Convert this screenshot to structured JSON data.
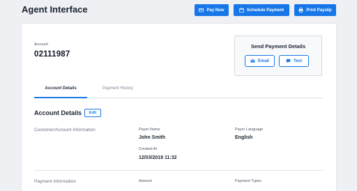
{
  "header": {
    "title": "Agent Interface",
    "buttons": [
      {
        "label": "Pay Now",
        "icon": "card-icon"
      },
      {
        "label": "Schedule Payment",
        "icon": "calendar-icon"
      },
      {
        "label": "Print Payslip",
        "icon": "printer-icon"
      }
    ]
  },
  "account": {
    "label": "Account",
    "number": "02111987"
  },
  "send_payment": {
    "title": "Send Payment Details",
    "email_label": "Email",
    "text_label": "Text"
  },
  "tabs": [
    {
      "label": "Account Details",
      "active": true
    },
    {
      "label": "Payment History",
      "active": false
    }
  ],
  "account_details": {
    "title": "Account Details",
    "edit_label": "Edit",
    "customer_section": "Customer/Account Information",
    "payer_name_label": "Payer Name",
    "payer_name": "John Smith",
    "payer_language_label": "Payer Language",
    "payer_language": "English",
    "created_at_label": "Created At",
    "created_at": "12/03/2019 11:32",
    "payment_section": "Payment Information",
    "amount_label": "Amount",
    "payment_types_label": "Payment Types"
  },
  "colors": {
    "accent": "#1777e8",
    "background": "#eef0f3",
    "card": "#ffffff"
  }
}
